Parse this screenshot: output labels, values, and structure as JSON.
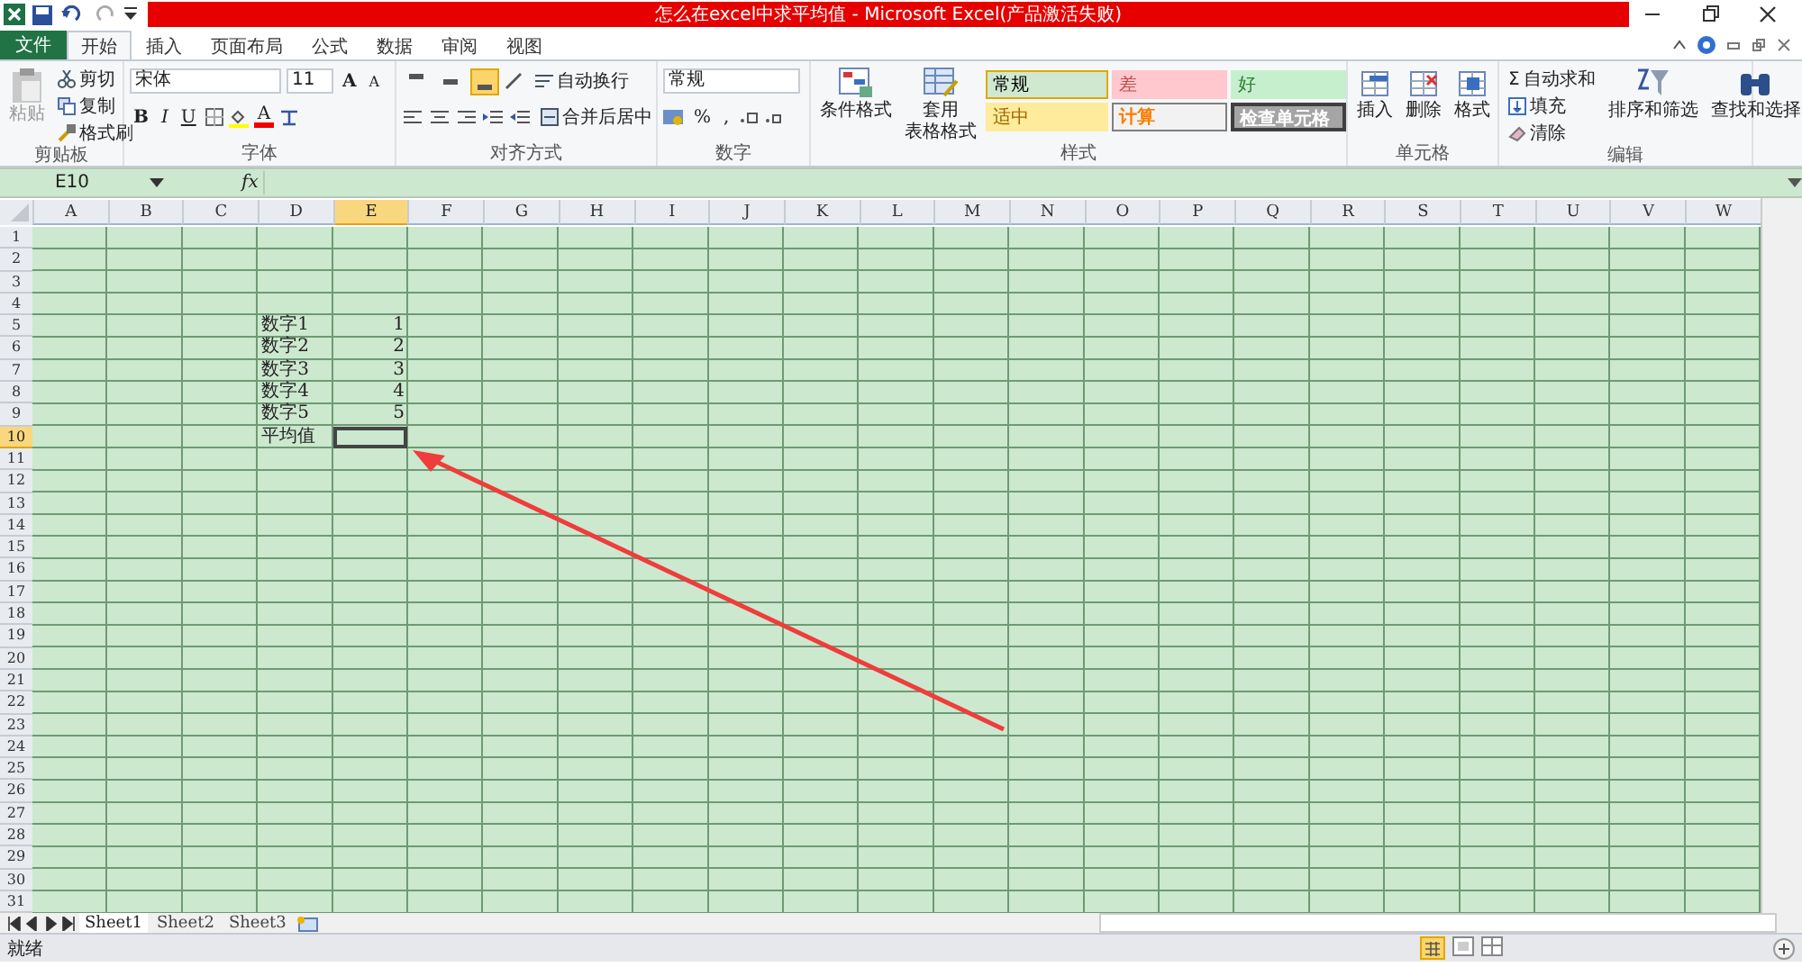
{
  "window": {
    "title": "怎么在excel中求平均值 - Microsoft Excel(产品激活失败)"
  },
  "tabs": [
    {
      "label": "文件",
      "selected": false,
      "kind": "file"
    },
    {
      "label": "开始",
      "selected": true,
      "kind": "tab"
    },
    {
      "label": "插入",
      "selected": false,
      "kind": "tab"
    },
    {
      "label": "页面布局",
      "selected": false,
      "kind": "tab"
    },
    {
      "label": "公式",
      "selected": false,
      "kind": "tab"
    },
    {
      "label": "数据",
      "selected": false,
      "kind": "tab"
    },
    {
      "label": "审阅",
      "selected": false,
      "kind": "tab"
    },
    {
      "label": "视图",
      "selected": false,
      "kind": "tab"
    }
  ],
  "clipboard": {
    "paste": "粘贴",
    "items": [
      "剪切",
      "复制",
      "格式刷"
    ],
    "label": "剪贴板"
  },
  "font": {
    "name": "宋体",
    "size": "11",
    "grow": "A",
    "shrink": "A",
    "styles": [
      "B",
      "I",
      "U"
    ],
    "color_button": "A",
    "label": "字体"
  },
  "alignment": {
    "vertical_align": [
      {
        "selected": false
      },
      {
        "selected": false
      },
      {
        "selected": true
      }
    ],
    "wrap": "自动换行",
    "merge": "合并后居中",
    "label": "对齐方式"
  },
  "number": {
    "format": "常规",
    "percent": "%",
    "comma": ",",
    "label": "数字"
  },
  "styles": {
    "conditional": "条件格式",
    "table": "套用",
    "table_2": "表格格式",
    "cell_styles": [
      {
        "label": "常规",
        "kind": "normal"
      },
      {
        "label": "差",
        "kind": "bad"
      },
      {
        "label": "好",
        "kind": "good"
      },
      {
        "label": "适中",
        "kind": "neutral"
      },
      {
        "label": "计算",
        "kind": "calculation"
      },
      {
        "label": "检查单元格",
        "kind": "check"
      }
    ],
    "label": "样式"
  },
  "cells": {
    "buttons": [
      "插入",
      "删除",
      "格式"
    ],
    "label": "单元格"
  },
  "editing": {
    "sigma": "Σ",
    "items": [
      "自动求和",
      "填充",
      "清除"
    ],
    "sort": "排序和筛选",
    "find": "查找和选择",
    "label": "编辑"
  },
  "formula_bar": {
    "name_box": "E10",
    "fx": "fx"
  },
  "grid": {
    "columns": [
      {
        "label": "A",
        "selected": false
      },
      {
        "label": "B",
        "selected": false
      },
      {
        "label": "C",
        "selected": false
      },
      {
        "label": "D",
        "selected": false
      },
      {
        "label": "E",
        "selected": true
      },
      {
        "label": "F",
        "selected": false
      },
      {
        "label": "G",
        "selected": false
      },
      {
        "label": "H",
        "selected": false
      },
      {
        "label": "I",
        "selected": false
      },
      {
        "label": "J",
        "selected": false
      },
      {
        "label": "K",
        "selected": false
      },
      {
        "label": "L",
        "selected": false
      },
      {
        "label": "M",
        "selected": false
      },
      {
        "label": "N",
        "selected": false
      },
      {
        "label": "O",
        "selected": false
      },
      {
        "label": "P",
        "selected": false
      },
      {
        "label": "Q",
        "selected": false
      },
      {
        "label": "R",
        "selected": false
      },
      {
        "label": "S",
        "selected": false
      },
      {
        "label": "T",
        "selected": false
      },
      {
        "label": "U",
        "selected": false
      },
      {
        "label": "V",
        "selected": false
      },
      {
        "label": "W",
        "selected": false
      }
    ],
    "rows": [
      {
        "label": "1",
        "selected": false
      },
      {
        "label": "2",
        "selected": false
      },
      {
        "label": "3",
        "selected": false
      },
      {
        "label": "4",
        "selected": false
      },
      {
        "label": "5",
        "selected": false,
        "cells": [
          {
            "kind": "label",
            "text": "数字1",
            "selected": false
          },
          {
            "kind": "value",
            "text": "1",
            "selected": false
          }
        ]
      },
      {
        "label": "6",
        "selected": false,
        "cells": [
          {
            "kind": "label",
            "text": "数字2",
            "selected": false
          },
          {
            "kind": "value",
            "text": "2",
            "selected": false
          }
        ]
      },
      {
        "label": "7",
        "selected": false,
        "cells": [
          {
            "kind": "label",
            "text": "数字3",
            "selected": false
          },
          {
            "kind": "value",
            "text": "3",
            "selected": false
          }
        ]
      },
      {
        "label": "8",
        "selected": false,
        "cells": [
          {
            "kind": "label",
            "text": "数字4",
            "selected": false
          },
          {
            "kind": "value",
            "text": "4",
            "selected": false
          }
        ]
      },
      {
        "label": "9",
        "selected": false,
        "cells": [
          {
            "kind": "label",
            "text": "数字5",
            "selected": false
          },
          {
            "kind": "value",
            "text": "5",
            "selected": false
          }
        ]
      },
      {
        "label": "10",
        "selected": true,
        "cells": [
          {
            "kind": "label",
            "text": "平均值",
            "selected": false
          },
          {
            "kind": "value",
            "selected": true
          }
        ]
      },
      {
        "label": "11",
        "selected": false
      },
      {
        "label": "12",
        "selected": false
      },
      {
        "label": "13",
        "selected": false
      },
      {
        "label": "14",
        "selected": false
      },
      {
        "label": "15",
        "selected": false
      },
      {
        "label": "16",
        "selected": false
      },
      {
        "label": "17",
        "selected": false
      },
      {
        "label": "18",
        "selected": false
      },
      {
        "label": "19",
        "selected": false
      },
      {
        "label": "20",
        "selected": false
      },
      {
        "label": "21",
        "selected": false
      },
      {
        "label": "22",
        "selected": false
      },
      {
        "label": "23",
        "selected": false
      },
      {
        "label": "24",
        "selected": false
      },
      {
        "label": "25",
        "selected": false
      },
      {
        "label": "26",
        "selected": false
      },
      {
        "label": "27",
        "selected": false
      },
      {
        "label": "28",
        "selected": false
      },
      {
        "label": "29",
        "selected": false
      },
      {
        "label": "30",
        "selected": false
      },
      {
        "label": "31",
        "selected": false
      }
    ]
  },
  "sheets": [
    {
      "label": "Sheet1",
      "selected": true
    },
    {
      "label": "Sheet2",
      "selected": false
    },
    {
      "label": "Sheet3",
      "selected": false
    }
  ],
  "status_bar": {
    "text": "就绪"
  }
}
